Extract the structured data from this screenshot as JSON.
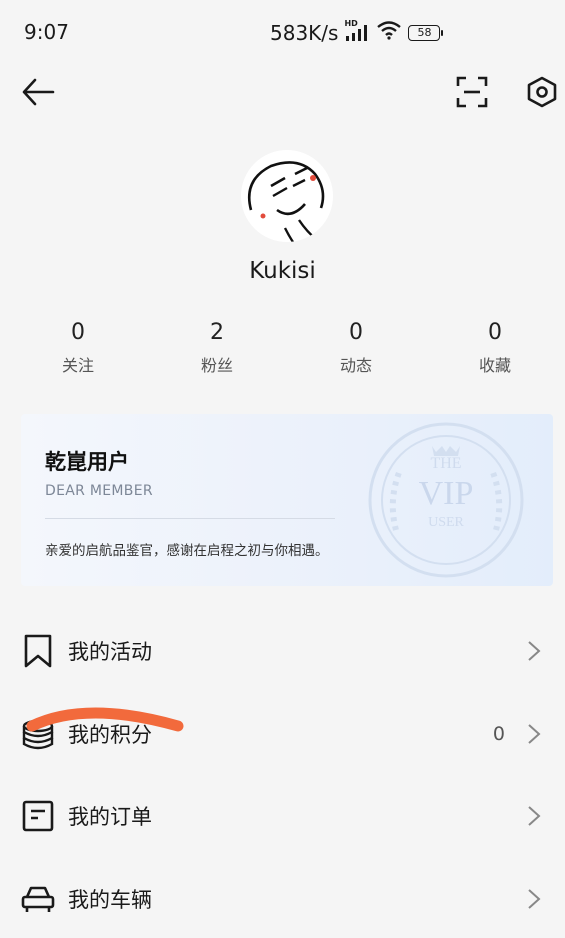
{
  "status_bar": {
    "time": "9:07",
    "net_speed": "583K/s",
    "network_badge": "HD",
    "battery": "58",
    "icons": [
      "signal-icon",
      "wifi-icon",
      "battery-icon"
    ]
  },
  "header": {
    "back_icon": "back-arrow-icon",
    "scan_icon": "scan-icon",
    "settings_icon": "settings-hexagon-icon"
  },
  "profile": {
    "username": "Kukisi",
    "stats": [
      {
        "value": "0",
        "label": "关注"
      },
      {
        "value": "2",
        "label": "粉丝"
      },
      {
        "value": "0",
        "label": "动态"
      },
      {
        "value": "0",
        "label": "收藏"
      }
    ]
  },
  "vip_card": {
    "title": "乾崑用户",
    "subtitle": "DEAR MEMBER",
    "message": "亲爱的启航品鉴官，感谢在启程之初与你相遇。",
    "badge_top": "THE",
    "badge_main": "VIP",
    "badge_bottom": "USER"
  },
  "menu": [
    {
      "label": "我的活动",
      "icon": "bookmark-icon",
      "value": ""
    },
    {
      "label": "我的积分",
      "icon": "coins-icon",
      "value": "0"
    },
    {
      "label": "我的订单",
      "icon": "order-icon",
      "value": ""
    },
    {
      "label": "我的车辆",
      "icon": "car-icon",
      "value": ""
    }
  ],
  "colors": {
    "background": "#f5f5f5",
    "annotation_stroke": "#f26a3c",
    "vip_card_gradient_end": "#e3edfb"
  }
}
